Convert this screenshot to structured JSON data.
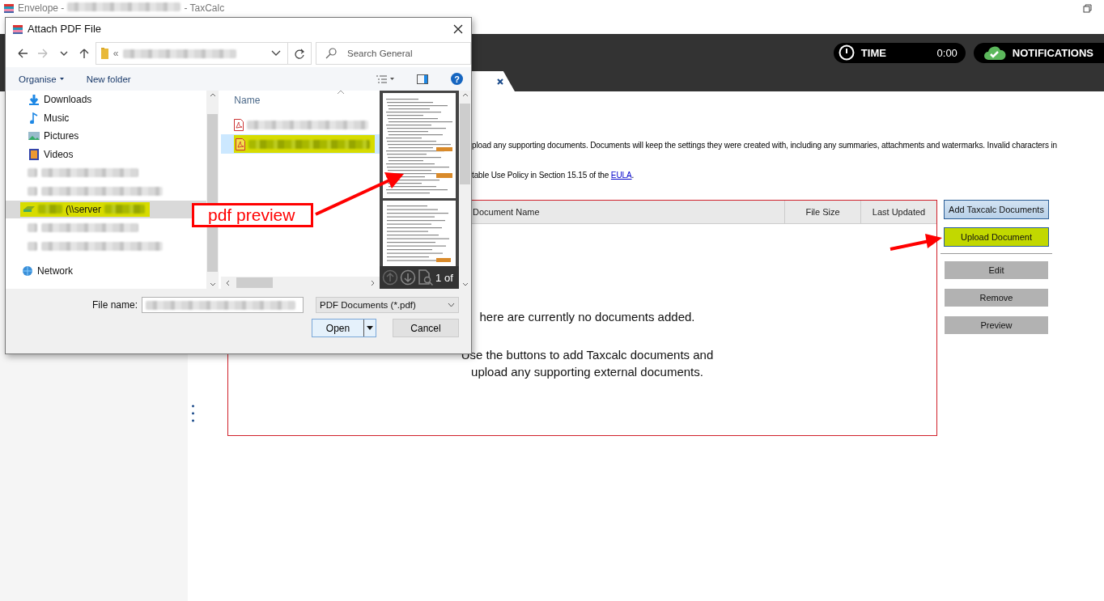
{
  "app_title": {
    "prefix": "Envelope -",
    "suffix": "- TaxCalc"
  },
  "header": {
    "timer": {
      "label": "TIME",
      "value": "0:00"
    },
    "notifications": {
      "label": "NOTIFICATIONS"
    }
  },
  "intro": {
    "line_1": "pload any supporting documents. Documents will keep the settings they were created with, including any summaries, attachments and watermarks. Invalid characters in",
    "line_2": "table Use Policy in Section 15.15 of the ",
    "link": "EULA",
    "line_2_end": "."
  },
  "table": {
    "columns": [
      "Document Name",
      "File Size",
      "Last Updated"
    ],
    "empty_message": [
      "here are currently no documents added.",
      "Use the buttons to add Taxcalc documents and upload any supporting external documents."
    ]
  },
  "add_actions": [
    {
      "label": "Add Taxcalc Documents",
      "kind": "primary"
    },
    {
      "label": "Upload Document",
      "kind": "highlight"
    }
  ],
  "edit_actions": [
    {
      "label": "Edit",
      "disabled": true
    },
    {
      "label": "Remove",
      "disabled": true
    },
    {
      "label": "Preview",
      "disabled": true
    }
  ],
  "dialog": {
    "title": "Attach PDF File",
    "address_prefix": "«",
    "search": {
      "placeholder": "Search General"
    },
    "toolbar": {
      "organise": "Organise",
      "new_folder": "New folder",
      "help": "?"
    },
    "nav_items": [
      {
        "kind": "downloads",
        "label": "Downloads",
        "selected": false,
        "highlighted": false
      },
      {
        "kind": "music",
        "label": "Music",
        "selected": false,
        "highlighted": false
      },
      {
        "kind": "pictures",
        "label": "Pictures",
        "selected": false,
        "highlighted": false
      },
      {
        "kind": "videos",
        "label": "Videos",
        "selected": false,
        "highlighted": false
      },
      {
        "kind": "blurred",
        "selected": false,
        "highlighted": false
      },
      {
        "kind": "blurred",
        "selected": false,
        "highlighted": false
      },
      {
        "kind": "drive",
        "label": "(\\\\server",
        "selected": true,
        "highlighted": true
      },
      {
        "kind": "blurred",
        "selected": false,
        "highlighted": false
      },
      {
        "kind": "blurred",
        "selected": false,
        "highlighted": false
      },
      {
        "kind": "network",
        "label": "Network",
        "selected": false,
        "highlighted": false
      }
    ],
    "files": {
      "column": "Name",
      "items": [
        {
          "selected": false,
          "highlighted": false
        },
        {
          "selected": true,
          "highlighted": true
        }
      ]
    },
    "preview": {
      "page_label": "1 of"
    },
    "file_name": {
      "label": "File name:"
    },
    "filter": {
      "value": "PDF Documents (*.pdf)"
    },
    "buttons": {
      "open": "Open",
      "cancel": "Cancel"
    }
  },
  "annotations": [
    {
      "kind": "callout",
      "text": "pdf preview"
    },
    {
      "kind": "arrow"
    }
  ]
}
